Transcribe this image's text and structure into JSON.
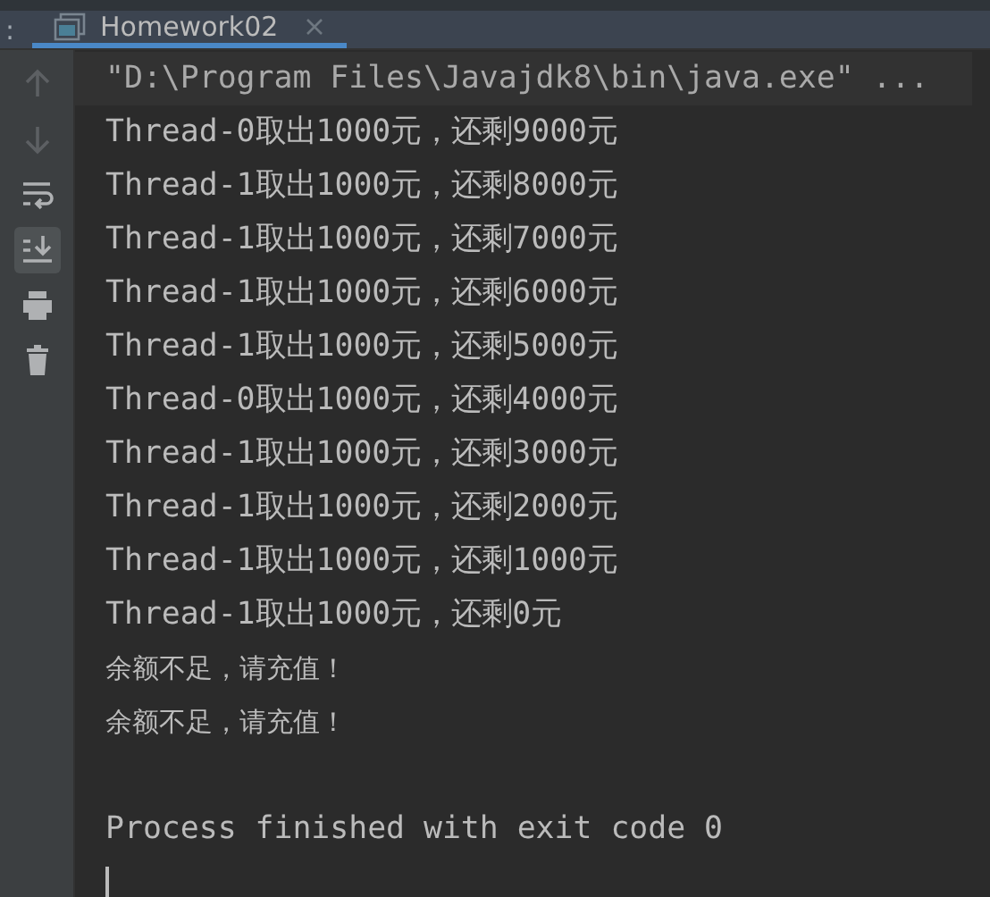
{
  "header": {
    "label": ":",
    "tab": {
      "title": "Homework02",
      "selected": true
    }
  },
  "toolbar": [
    {
      "kind": "up",
      "disabled": true,
      "selected": false
    },
    {
      "kind": "down",
      "disabled": true,
      "selected": false
    },
    {
      "kind": "wrap",
      "disabled": false,
      "selected": false
    },
    {
      "kind": "scroll-end",
      "disabled": false,
      "selected": true
    },
    {
      "kind": "print",
      "disabled": false,
      "selected": false
    },
    {
      "kind": "trash",
      "disabled": false,
      "selected": false
    }
  ],
  "console": {
    "lines": [
      {
        "kind": "command",
        "text": "\"D:\\Program Files\\Javajdk8\\bin\\java.exe\" ..."
      },
      {
        "kind": "output",
        "text": "Thread-0取出1000元，还剩9000元"
      },
      {
        "kind": "output",
        "text": "Thread-1取出1000元，还剩8000元"
      },
      {
        "kind": "output",
        "text": "Thread-1取出1000元，还剩7000元"
      },
      {
        "kind": "output",
        "text": "Thread-1取出1000元，还剩6000元"
      },
      {
        "kind": "output",
        "text": "Thread-1取出1000元，还剩5000元"
      },
      {
        "kind": "output",
        "text": "Thread-0取出1000元，还剩4000元"
      },
      {
        "kind": "output",
        "text": "Thread-1取出1000元，还剩3000元"
      },
      {
        "kind": "output",
        "text": "Thread-1取出1000元，还剩2000元"
      },
      {
        "kind": "output",
        "text": "Thread-1取出1000元，还剩1000元"
      },
      {
        "kind": "output",
        "text": "Thread-1取出1000元，还剩0元"
      },
      {
        "kind": "output-cjk",
        "text": "余额不足，请充值！"
      },
      {
        "kind": "output-cjk",
        "text": "余额不足，请充值！"
      },
      {
        "kind": "blank"
      },
      {
        "kind": "output",
        "text": "Process finished with exit code 0"
      },
      {
        "kind": "cursor"
      }
    ]
  }
}
